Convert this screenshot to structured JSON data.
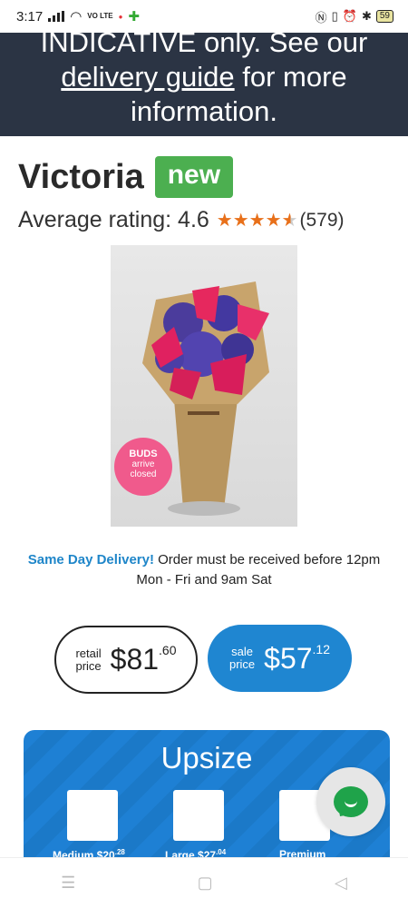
{
  "status": {
    "time": "3:17",
    "net": "VO LTE",
    "battery": "59"
  },
  "banner": {
    "line1": "INDICATIVE only. See our",
    "link": "delivery guide",
    "line2_rest": " for more",
    "line3": "information."
  },
  "product": {
    "title": "Victoria",
    "badge": "new",
    "rating_label": "Average rating: 4.6",
    "rating_value": 4.6,
    "rating_count": "(579)"
  },
  "image_badge": {
    "line1": "BUDS",
    "line2": "arrive",
    "line3": "closed"
  },
  "delivery": {
    "highlight": "Same Day Delivery!",
    "text": " Order must be received before 12pm",
    "line2": "Mon - Fri and 9am Sat"
  },
  "retail": {
    "label1": "retail",
    "label2": "price",
    "dollars": "$81",
    "cents": ".60"
  },
  "sale": {
    "label1": "sale",
    "label2": "price",
    "dollars": "$57",
    "cents": ".12"
  },
  "upsize": {
    "title": "Upsize",
    "options": [
      {
        "name": "Medium",
        "price": "$20",
        "cents": ".28"
      },
      {
        "name": "Large",
        "price": "$27",
        "cents": ".04"
      },
      {
        "name": "Premium",
        "price": "",
        "cents": ""
      }
    ]
  },
  "colors": {
    "banner": "#2b3444",
    "badge": "#4caf50",
    "star": "#e8701a",
    "sale": "#1f86d1",
    "chat": "#1fa34a"
  }
}
